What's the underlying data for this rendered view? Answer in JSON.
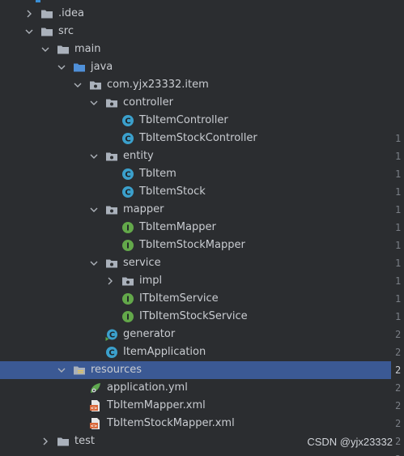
{
  "colors": {
    "background": "#2b2d30",
    "selection": "#3b5994",
    "text": "#c9ccd1",
    "folder": "#aab1bb",
    "package_folder": "#4f90d9",
    "class_blue": "#3ba0cc",
    "interface_green": "#63a84a",
    "xml_orange": "#d9683a",
    "yaml_green": "#5fa84f"
  },
  "tree": {
    "items": [
      {
        "label": ".idea",
        "icon": "folder-icon",
        "chevron": "chevron-right"
      },
      {
        "label": "src",
        "icon": "folder-icon",
        "chevron": "chevron-down"
      },
      {
        "label": "main",
        "icon": "folder-icon",
        "chevron": "chevron-down"
      },
      {
        "label": "java",
        "icon": "source-folder-icon",
        "chevron": "chevron-down"
      },
      {
        "label": "com.yjx23332.item",
        "icon": "package-icon",
        "chevron": "chevron-down"
      },
      {
        "label": "controller",
        "icon": "package-icon",
        "chevron": "chevron-down"
      },
      {
        "label": "TbItemController",
        "icon": "class-icon",
        "chevron": ""
      },
      {
        "label": "TbItemStockController",
        "icon": "class-icon",
        "chevron": ""
      },
      {
        "label": "entity",
        "icon": "package-icon",
        "chevron": "chevron-down"
      },
      {
        "label": "TbItem",
        "icon": "class-icon",
        "chevron": ""
      },
      {
        "label": "TbItemStock",
        "icon": "class-icon",
        "chevron": ""
      },
      {
        "label": "mapper",
        "icon": "package-icon",
        "chevron": "chevron-down"
      },
      {
        "label": "TbItemMapper",
        "icon": "interface-icon",
        "chevron": ""
      },
      {
        "label": "TbItemStockMapper",
        "icon": "interface-icon",
        "chevron": ""
      },
      {
        "label": "service",
        "icon": "package-icon",
        "chevron": "chevron-down"
      },
      {
        "label": "impl",
        "icon": "package-icon",
        "chevron": "chevron-right"
      },
      {
        "label": "ITbItemService",
        "icon": "interface-icon",
        "chevron": ""
      },
      {
        "label": "ITbItemStockService",
        "icon": "interface-icon",
        "chevron": ""
      },
      {
        "label": "generator",
        "icon": "runnable-class-icon",
        "chevron": ""
      },
      {
        "label": "ItemApplication",
        "icon": "class-icon",
        "chevron": ""
      },
      {
        "label": "resources",
        "icon": "resources-folder-icon",
        "chevron": "chevron-down"
      },
      {
        "label": "application.yml",
        "icon": "yaml-file-icon",
        "chevron": ""
      },
      {
        "label": "TbItemMapper.xml",
        "icon": "xml-file-icon",
        "chevron": ""
      },
      {
        "label": "TbItemStockMapper.xml",
        "icon": "xml-file-icon",
        "chevron": ""
      },
      {
        "label": "test",
        "icon": "folder-icon",
        "chevron": "chevron-right"
      }
    ]
  },
  "gutter": {
    "numbers": [
      "1",
      "1",
      "1",
      "1",
      "1",
      "1",
      "1",
      "1",
      "1",
      "1",
      "1",
      "2",
      "2",
      "2",
      "2",
      "2",
      "2",
      "2",
      "2"
    ]
  },
  "watermark": {
    "text": "CSDN @yjx23332"
  }
}
